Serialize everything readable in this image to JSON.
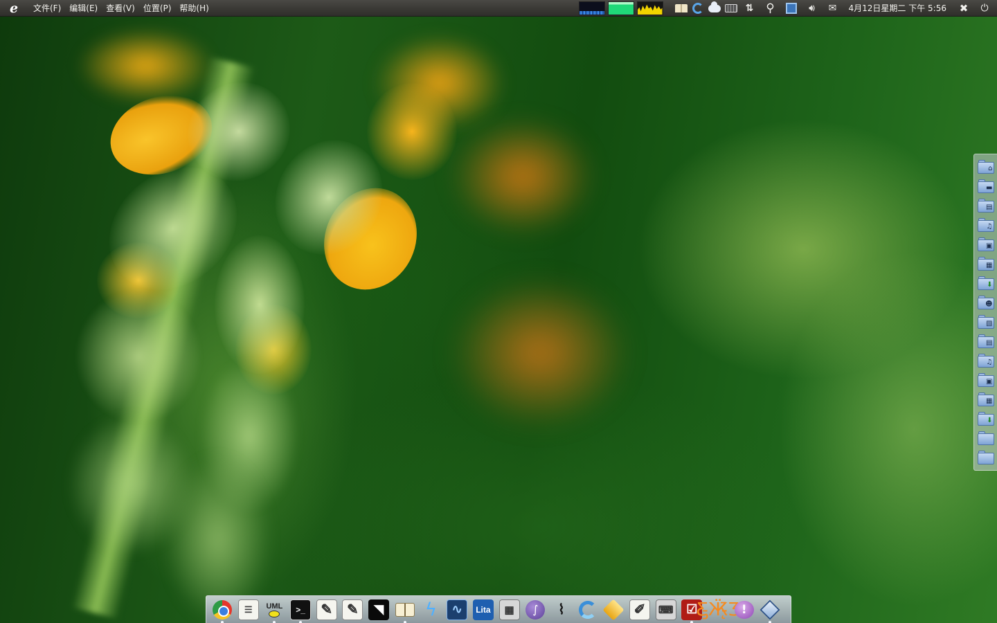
{
  "top_panel": {
    "logo_glyph": "e",
    "menus": [
      "文件(F)",
      "编辑(E)",
      "查看(V)",
      "位置(P)",
      "帮助(H)"
    ],
    "tray_icons": [
      "cpu-graph-icon",
      "memory-graph-icon",
      "network-graph-icon",
      "dictionary-icon",
      "swirl-icon",
      "cloud-icon",
      "keyboard-icon",
      "network-arrows-icon",
      "accessibility-icon",
      "vm-icon",
      "volume-icon",
      "mail-icon",
      "session-icon",
      "power-icon"
    ],
    "clock": "4月12日星期二 下午 5:56"
  },
  "side_shelf": {
    "folders": [
      "home-folder",
      "desktop-folder",
      "documents-folder",
      "music-folder",
      "pictures-folder",
      "videos-folder",
      "downloads-folder",
      "public-folder",
      "templates-folder",
      "documents-folder-2",
      "music-folder-2",
      "pictures-folder-2",
      "videos-folder-2",
      "downloads-folder-2",
      "folder-1",
      "folder-2"
    ]
  },
  "dock": {
    "items": [
      "chrome",
      "notes",
      "uml-editor",
      "terminal",
      "text-editor",
      "text-editor-2",
      "inkscape",
      "dictionary",
      "bolt-app",
      "oscilloscope",
      "lita",
      "calculator",
      "orb-app",
      "plotter",
      "swirl-app",
      "gold-app",
      "document-editor",
      "network-tool",
      "checklist",
      "butterfly",
      "chat",
      "virtualbox"
    ],
    "lita_label": "Lita",
    "uml_label": "UML",
    "colors": {
      "dock_bg": "#c8ced8",
      "indicator": "#f4f8ff"
    }
  },
  "colors": {
    "panel_bg": "#3a3935",
    "panel_text": "#f2f1ed",
    "accent": "#f2d400"
  }
}
